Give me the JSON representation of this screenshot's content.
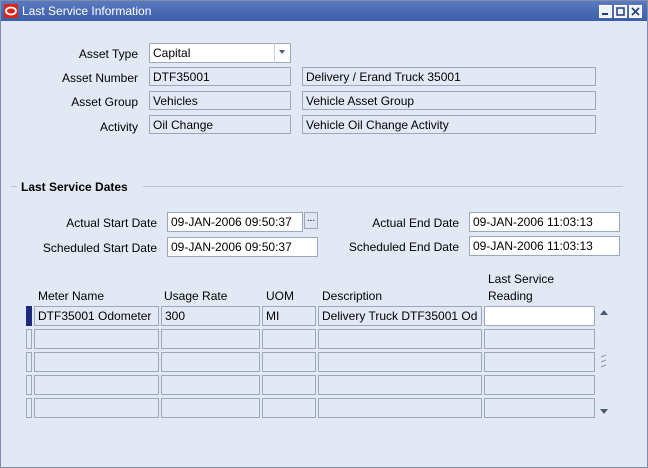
{
  "window": {
    "title": "Last Service Information"
  },
  "asset": {
    "type_label": "Asset Type",
    "type_value": "Capital",
    "number_label": "Asset Number",
    "number_value": "DTF35001",
    "number_desc": "Delivery / Erand Truck 35001",
    "group_label": "Asset Group",
    "group_value": "Vehicles",
    "group_desc": "Vehicle Asset Group",
    "activity_label": "Activity",
    "activity_value": "Oil Change",
    "activity_desc": "Vehicle Oil Change Activity"
  },
  "dates": {
    "section_title": "Last Service Dates",
    "actual_start_label": "Actual Start Date",
    "actual_start_value": "09-JAN-2006 09:50:37",
    "actual_end_label": "Actual End Date",
    "actual_end_value": "09-JAN-2006 11:03:13",
    "sched_start_label": "Scheduled Start Date",
    "sched_start_value": "09-JAN-2006 09:50:37",
    "sched_end_label": "Scheduled End Date",
    "sched_end_value": "09-JAN-2006 11:03:13",
    "lov_label": "..."
  },
  "meters": {
    "columns": [
      "Meter Name",
      "Usage Rate",
      "UOM",
      "Description"
    ],
    "last_reading_header_1": "Last Service",
    "last_reading_header_2": "Reading",
    "rows": [
      {
        "meter_name": "DTF35001 Odometer",
        "usage_rate": "300",
        "uom": "MI",
        "description": "Delivery Truck DTF35001 Od",
        "last_reading": ""
      },
      {
        "meter_name": "",
        "usage_rate": "",
        "uom": "",
        "description": "",
        "last_reading": ""
      },
      {
        "meter_name": "",
        "usage_rate": "",
        "uom": "",
        "description": "",
        "last_reading": ""
      },
      {
        "meter_name": "",
        "usage_rate": "",
        "uom": "",
        "description": "",
        "last_reading": ""
      },
      {
        "meter_name": "",
        "usage_rate": "",
        "uom": "",
        "description": "",
        "last_reading": ""
      }
    ]
  },
  "icons": {
    "app": "oracle-icon",
    "minimize": "minimize-icon",
    "maximize": "maximize-icon",
    "close": "close-icon",
    "dropdown": "chevron-down-icon",
    "scroll_up": "scroll-up-icon",
    "scroll_down": "scroll-down-icon"
  },
  "colors": {
    "titlebar": "#3a5ea9",
    "background": "#e3e9f4",
    "selected_row": "#1b2a7a"
  }
}
